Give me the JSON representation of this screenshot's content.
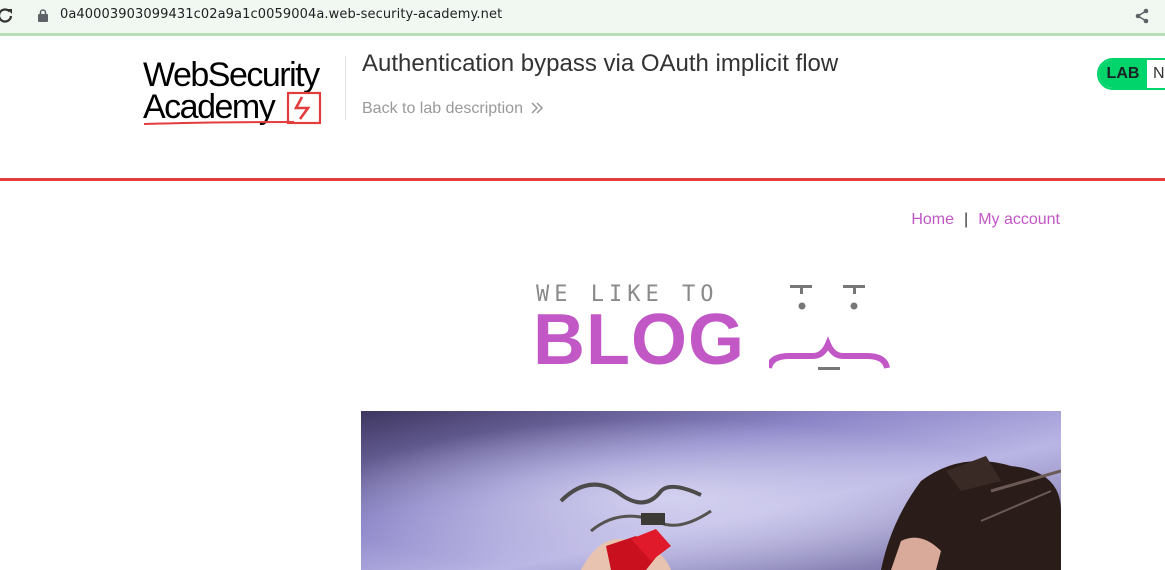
{
  "browser": {
    "url": "0a40003903099431c02a9a1c0059004a.web-security-academy.net",
    "icons": [
      "reload-icon",
      "lock-icon",
      "share-icon"
    ]
  },
  "lab_header": {
    "logo_line1": "WebSecurity",
    "logo_line2": "Academy",
    "title": "Authentication bypass via OAuth implicit flow",
    "back_link": "Back to lab description",
    "status_label": "LAB",
    "status_text": "N"
  },
  "nav": {
    "home": "Home",
    "separator": "|",
    "my_account": "My account"
  },
  "banner": {
    "top_text": "WE LIKE TO",
    "main_text": "BLOG"
  },
  "colors": {
    "accent_red": "#e23c3c",
    "blog_purple": "#c158c6",
    "status_green": "#00d46a"
  }
}
